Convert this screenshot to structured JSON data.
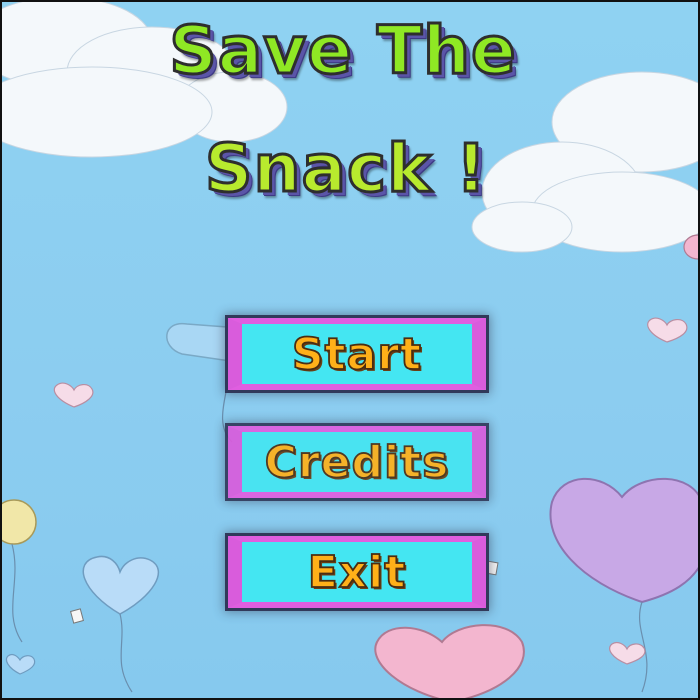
{
  "game": {
    "title_line1": "Save The",
    "title_line2": "Snack !"
  },
  "menu": {
    "start_label": "Start",
    "credits_label": "Credits",
    "exit_label": "Exit"
  },
  "colors": {
    "sky": "#8ccdf0",
    "title_fill": "#8fe824",
    "button_fill": "#44e6f2",
    "button_border": "#d95cdc",
    "button_text": "#ffb019"
  }
}
